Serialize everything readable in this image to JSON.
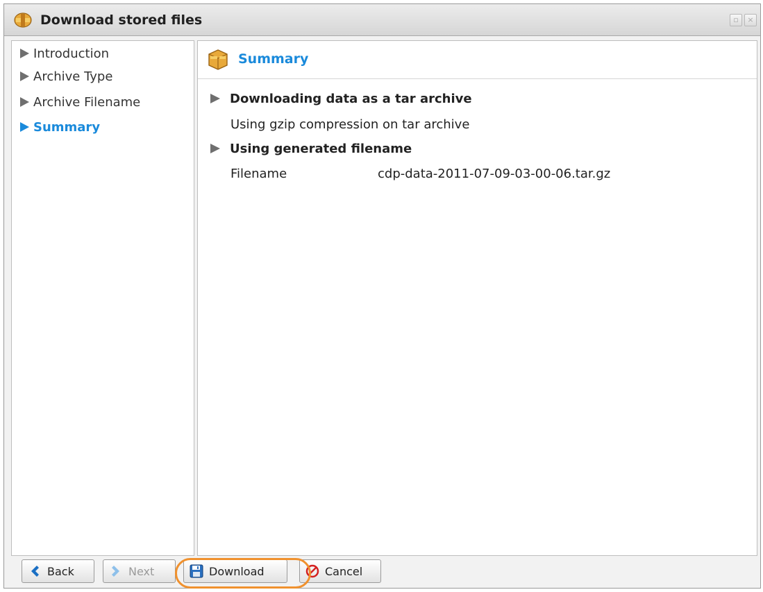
{
  "window": {
    "title": "Download stored files",
    "icon": "archive-icon"
  },
  "sidebar": {
    "items": [
      {
        "label": "Introduction",
        "active": false
      },
      {
        "label": "Archive Type",
        "active": false
      },
      {
        "label": "Archive Filename",
        "active": false
      },
      {
        "label": "Summary",
        "active": true
      }
    ]
  },
  "main": {
    "header_title": "Summary",
    "sections": [
      {
        "heading": "Downloading data as a tar archive",
        "detail": "Using gzip compression on tar archive"
      },
      {
        "heading": "Using generated filename",
        "field_label": "Filename",
        "field_value": "cdp-data-2011-07-09-03-00-06.tar.gz"
      }
    ]
  },
  "footer": {
    "back_label": "Back",
    "next_label": "Next",
    "download_label": "Download",
    "cancel_label": "Cancel",
    "next_disabled": true,
    "highlighted_button": "Download"
  },
  "colors": {
    "accent": "#1a8adb",
    "highlight": "#f0912e"
  }
}
